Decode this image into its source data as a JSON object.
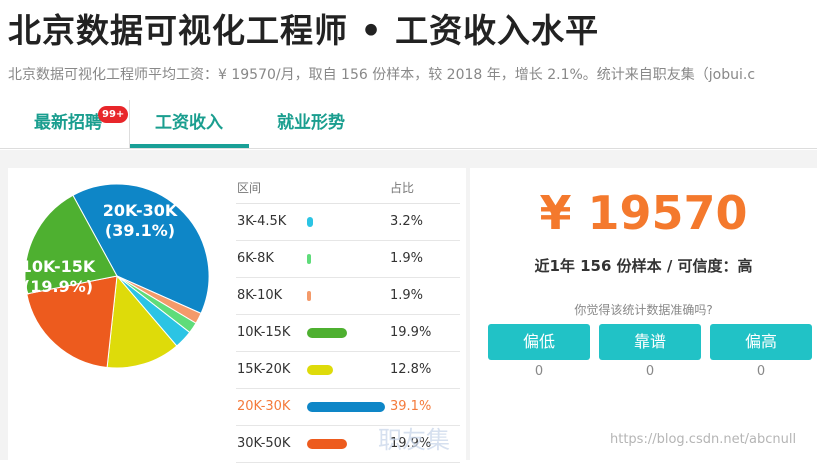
{
  "page": {
    "title": "北京数据可视化工程师 • 工资收入水平",
    "subtitle": "北京数据可视化工程师平均工资：¥ 19570/月，取自 156 份样本，较 2018 年，增长 2.1%。统计来自职友集（jobui.c"
  },
  "tabs": [
    {
      "label": "最新招聘",
      "badge": "99+"
    },
    {
      "label": "工资收入"
    },
    {
      "label": "就业形势"
    }
  ],
  "salary_table": {
    "header_range": "区间",
    "header_pct": "占比",
    "rows": [
      {
        "range": "3K-4.5K",
        "pct": "3.2%",
        "value": 3.2,
        "color": "#2bc4e4"
      },
      {
        "range": "6K-8K",
        "pct": "1.9%",
        "value": 1.9,
        "color": "#5fdc7a"
      },
      {
        "range": "8K-10K",
        "pct": "1.9%",
        "value": 1.9,
        "color": "#f49a6a"
      },
      {
        "range": "10K-15K",
        "pct": "19.9%",
        "value": 19.9,
        "color": "#4eb030"
      },
      {
        "range": "15K-20K",
        "pct": "12.8%",
        "value": 12.8,
        "color": "#dedb0a"
      },
      {
        "range": "20K-30K",
        "pct": "39.1%",
        "value": 39.1,
        "color": "#0e86c7"
      },
      {
        "range": "30K-50K",
        "pct": "19.9%",
        "value": 19.9,
        "color": "#ed5b1e"
      }
    ]
  },
  "chart_data": {
    "type": "pie",
    "slices": [
      {
        "label": "20K-30K",
        "value": 39.1,
        "color": "#0e86c7",
        "text": "20K-30K",
        "pct_text": "(39.1%)"
      },
      {
        "label": "8K-10K",
        "value": 1.9,
        "color": "#f49a6a"
      },
      {
        "label": "6K-8K",
        "value": 1.9,
        "color": "#5fdc7a"
      },
      {
        "label": "3K-4.5K",
        "value": 3.2,
        "color": "#2bc4e4"
      },
      {
        "label": "15K-20K",
        "value": 12.8,
        "color": "#dedb0a"
      },
      {
        "label": "30K-50K",
        "value": 19.9,
        "color": "#ed5b1e"
      },
      {
        "label": "10K-15K",
        "value": 19.9,
        "color": "#4eb030",
        "text": "10K-15K",
        "pct_text": "(19.9%)"
      }
    ]
  },
  "summary": {
    "price": "¥ 19570",
    "samples": "近1年 156 份样本 / 可信度：高",
    "question": "你觉得该统计数据准确吗?"
  },
  "vote_buttons": [
    {
      "label": "偏低",
      "count": "0"
    },
    {
      "label": "靠谱",
      "count": "0"
    },
    {
      "label": "偏高",
      "count": "0"
    }
  ],
  "watermarks": {
    "site_mark": "职友集",
    "csdn": "https://blog.csdn.net/abcnull"
  },
  "colors": {
    "accent": "#19a097",
    "price": "#f4792d",
    "button": "#21c2c6",
    "badge": "#e8262a"
  }
}
